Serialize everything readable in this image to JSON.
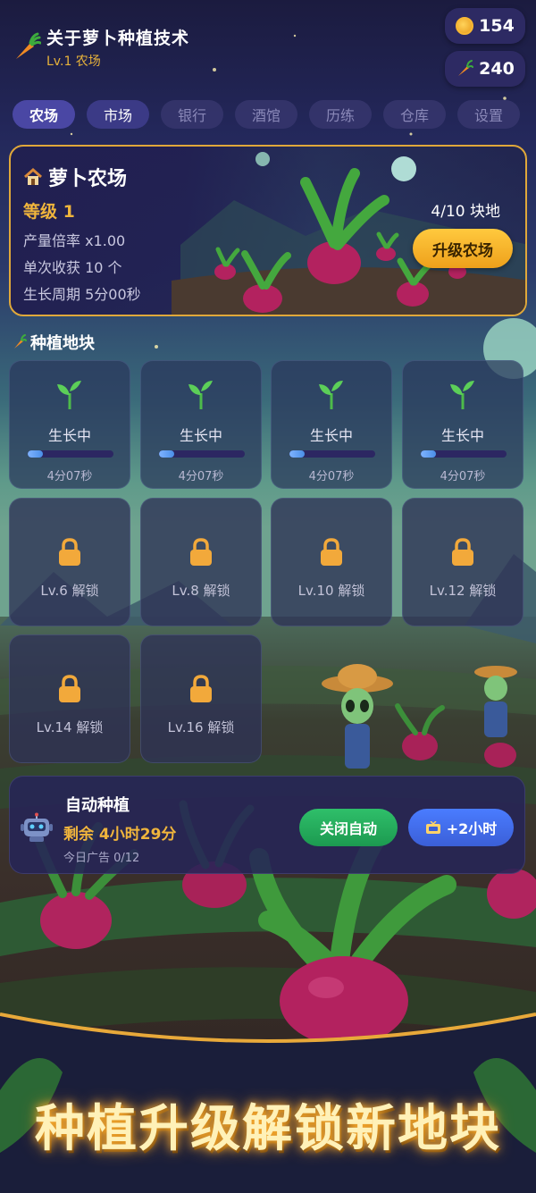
{
  "header": {
    "title": "关于萝卜种植技术",
    "subtitle": "Lv.1 农场",
    "coins": "154",
    "carrots": "240"
  },
  "tabs": [
    {
      "label": "农场",
      "active": true
    },
    {
      "label": "市场",
      "active": false
    },
    {
      "label": "银行",
      "active": false
    },
    {
      "label": "酒馆",
      "active": false
    },
    {
      "label": "历练",
      "active": false
    },
    {
      "label": "仓库",
      "active": false
    },
    {
      "label": "设置",
      "active": false
    }
  ],
  "farm": {
    "title": "萝卜农场",
    "level": "等级 1",
    "multiplier": "产量倍率 x1.00",
    "harvest": "单次收获 10 个",
    "cycle": "生长周期 5分00秒",
    "plots_count": "4/10 块地",
    "upgrade_label": "升级农场"
  },
  "plots_section": {
    "title": "种植地块",
    "growing": [
      {
        "status": "生长中",
        "time": "4分07秒",
        "progress": 0.18
      },
      {
        "status": "生长中",
        "time": "4分07秒",
        "progress": 0.18
      },
      {
        "status": "生长中",
        "time": "4分07秒",
        "progress": 0.18
      },
      {
        "status": "生长中",
        "time": "4分07秒",
        "progress": 0.18
      }
    ],
    "locked": [
      {
        "label": "Lv.6 解锁"
      },
      {
        "label": "Lv.8 解锁"
      },
      {
        "label": "Lv.10 解锁"
      },
      {
        "label": "Lv.12 解锁"
      },
      {
        "label": "Lv.14 解锁"
      },
      {
        "label": "Lv.16 解锁"
      }
    ]
  },
  "auto": {
    "title": "自动种植",
    "remaining": "剩余 4小时29分",
    "ads": "今日广告 0/12",
    "close_label": "关闭自动",
    "add_label": "+2小时"
  },
  "banner": "种植升级解锁新地块",
  "colors": {
    "accent_gold": "#f0b53c",
    "tab_active": "#4a47a4",
    "green_button": "#2fbf6a",
    "blue_button": "#4a7cff"
  },
  "icons": [
    "carrot-icon",
    "coin-icon",
    "house-icon",
    "sprout-icon",
    "lock-icon",
    "robot-icon",
    "tv-icon",
    "leaf-icon"
  ]
}
